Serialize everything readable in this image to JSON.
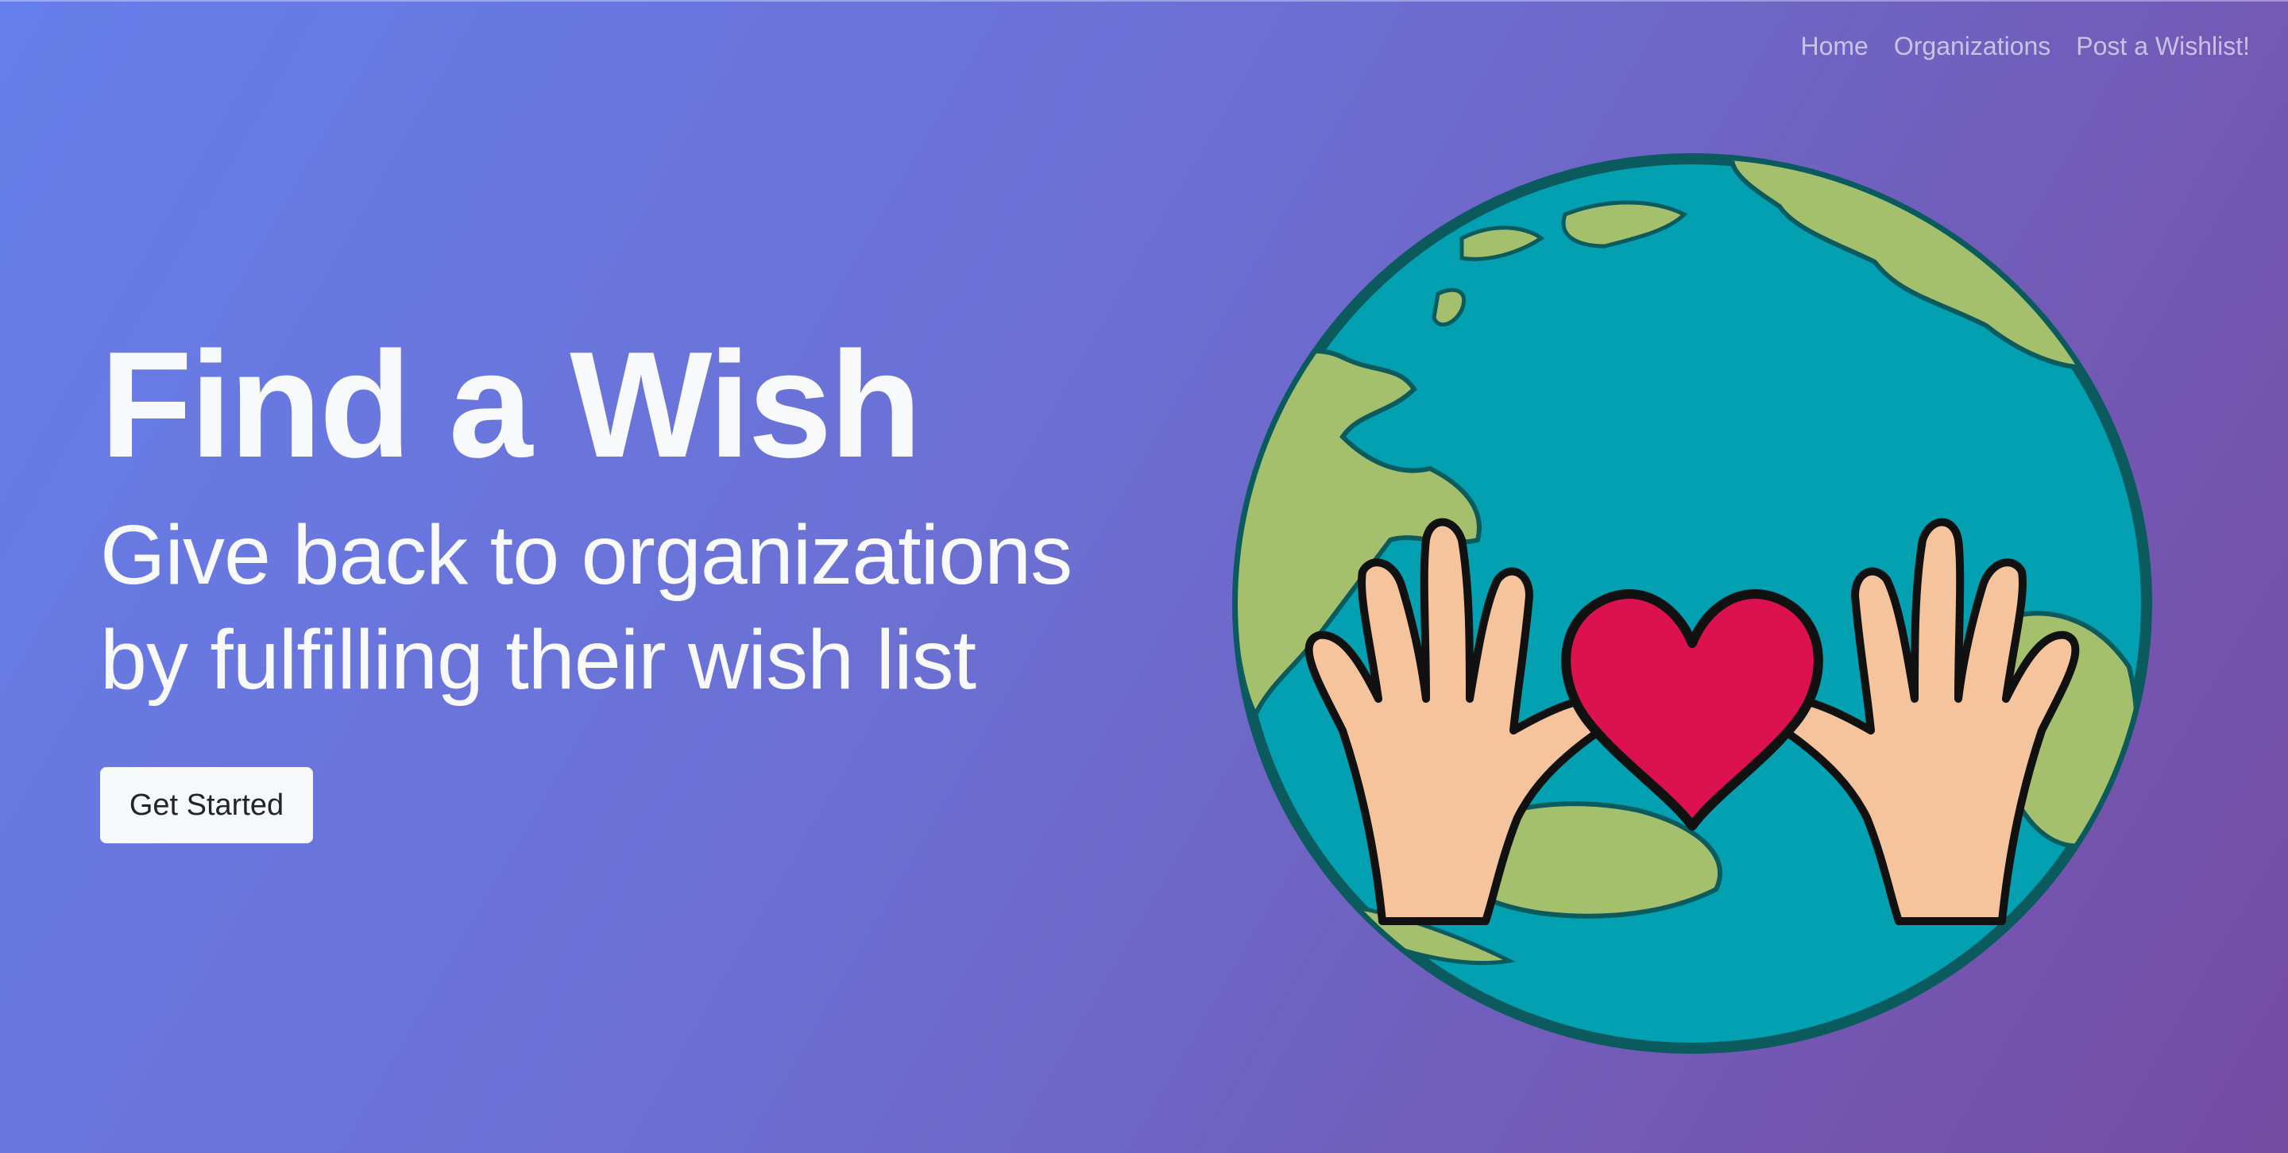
{
  "nav": {
    "items": [
      {
        "label": "Home"
      },
      {
        "label": "Organizations"
      },
      {
        "label": "Post a Wishlist!"
      }
    ]
  },
  "hero": {
    "title": "Find a Wish",
    "subtitle_line1": "Give back to organizations",
    "subtitle_line2": "by fulfilling their wish list",
    "cta_label": "Get Started",
    "illustration_icon": "globe-hands-heart-icon"
  },
  "colors": {
    "gradient_start": "#667eea",
    "gradient_end": "#764ba2",
    "ocean": "#02a0b0",
    "land": "#a4c06c",
    "heart": "#dc1150",
    "skin": "#f6c49c",
    "outline": "#0a5a5e"
  }
}
